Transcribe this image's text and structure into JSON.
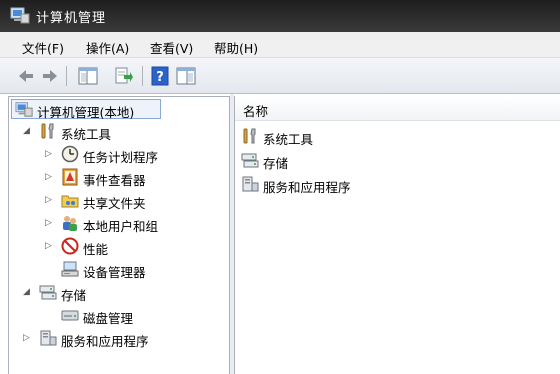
{
  "window": {
    "title": "计算机管理"
  },
  "menu": [
    "文件(F)",
    "操作(A)",
    "查看(V)",
    "帮助(H)"
  ],
  "toolbar": {
    "buttons": [
      "back-icon",
      "forward-icon",
      "show-hide-tree-icon",
      "export-list-icon",
      "help-icon",
      "show-action-pane-icon"
    ]
  },
  "tree": {
    "root": "计算机管理(本地)",
    "system_tools": "系统工具",
    "task_scheduler": "任务计划程序",
    "event_viewer": "事件查看器",
    "shared_folders": "共享文件夹",
    "local_users": "本地用户和组",
    "performance": "性能",
    "device_manager": "设备管理器",
    "storage": "存储",
    "disk_management": "磁盘管理",
    "services_apps": "服务和应用程序"
  },
  "list": {
    "header": "名称",
    "items": [
      "系统工具",
      "存储",
      "服务和应用程序"
    ]
  },
  "colors": {
    "titlebar": "#2a2a2a",
    "selection": "#eef3fb",
    "help": "#2d63c9"
  }
}
